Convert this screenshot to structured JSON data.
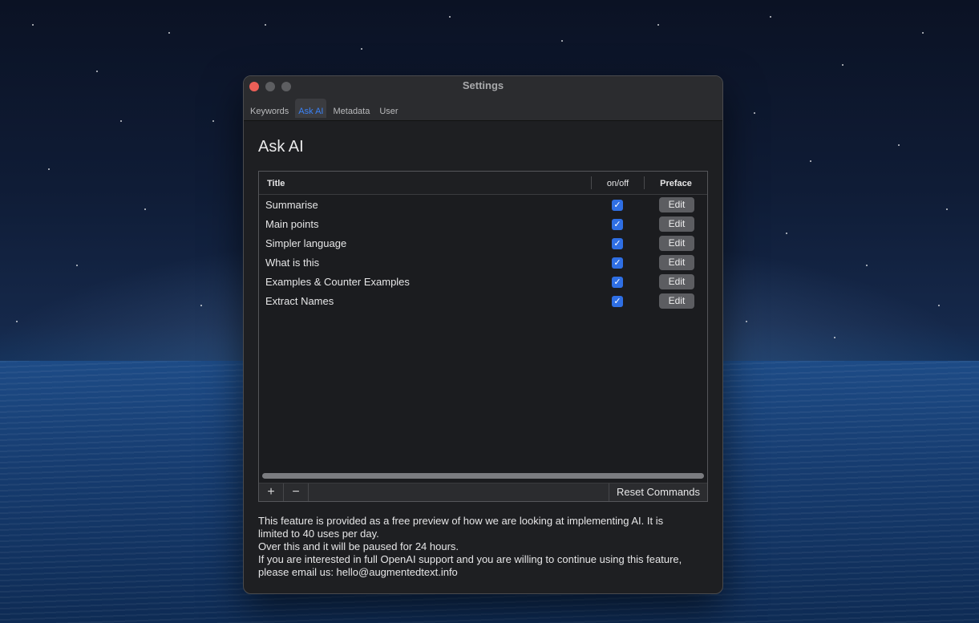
{
  "window": {
    "title": "Settings"
  },
  "tabs": [
    {
      "label": "Keywords",
      "active": false
    },
    {
      "label": "Ask AI",
      "active": true
    },
    {
      "label": "Metadata",
      "active": false
    },
    {
      "label": "User",
      "active": false
    }
  ],
  "page": {
    "title": "Ask AI"
  },
  "table": {
    "columns": {
      "title": "Title",
      "onoff": "on/off",
      "preface": "Preface"
    },
    "rows": [
      {
        "title": "Summarise",
        "enabled": true,
        "edit_label": "Edit"
      },
      {
        "title": "Main points",
        "enabled": true,
        "edit_label": "Edit"
      },
      {
        "title": "Simpler language",
        "enabled": true,
        "edit_label": "Edit"
      },
      {
        "title": "What is this",
        "enabled": true,
        "edit_label": "Edit"
      },
      {
        "title": "Examples & Counter Examples",
        "enabled": true,
        "edit_label": "Edit"
      },
      {
        "title": "Extract Names",
        "enabled": true,
        "edit_label": "Edit"
      }
    ]
  },
  "footer": {
    "add_label": "+",
    "remove_label": "−",
    "reset_label": "Reset Commands"
  },
  "info": {
    "lines": [
      "This feature is provided as a free preview of how we are looking at implementing AI. It is",
      "limited to 40 uses per day.",
      "Over this and it will be paused for 24 hours.",
      "If you are interested in full OpenAI support and you are willing to continue using this feature,",
      "please email us: hello@augmentedtext.info"
    ]
  },
  "colors": {
    "accent": "#3b82f6",
    "checkbox": "#2f6fe4",
    "close_button": "#ec5f57",
    "window_bg": "#1e1f22"
  }
}
